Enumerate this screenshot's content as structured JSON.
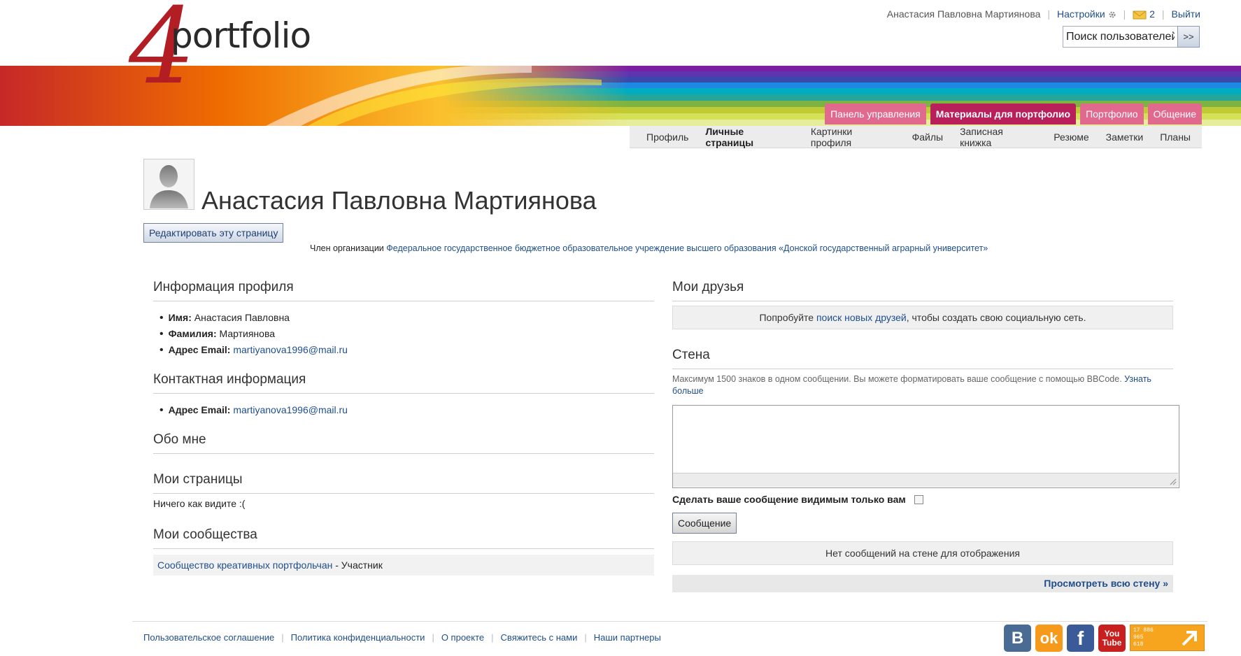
{
  "brand": {
    "logo_text": "portfolio",
    "logo_digit": "4"
  },
  "header": {
    "user_name": "Анастасия Павловна Мартиянова",
    "settings_label": "Настройки",
    "messages_count": "2",
    "logout_label": "Выйти",
    "search_placeholder": "Поиск пользователей",
    "search_button": ">>"
  },
  "main_tabs": [
    {
      "label": "Панель управления",
      "active": false
    },
    {
      "label": "Материалы для портфолио",
      "active": true
    },
    {
      "label": "Портфолио",
      "active": false
    },
    {
      "label": "Общение",
      "active": false
    }
  ],
  "sub_nav": [
    {
      "label": "Профиль",
      "active": false
    },
    {
      "label": "Личные страницы",
      "active": true
    },
    {
      "label": "Картинки профиля",
      "active": false
    },
    {
      "label": "Файлы",
      "active": false
    },
    {
      "label": "Записная книжка",
      "active": false
    },
    {
      "label": "Резюме",
      "active": false
    },
    {
      "label": "Заметки",
      "active": false
    },
    {
      "label": "Планы",
      "active": false
    }
  ],
  "profile": {
    "title": "Анастасия Павловна Мартиянова",
    "edit_button": "Редактировать эту страницу",
    "org_prefix": "Член организации",
    "org_name": "Федеральное государственное бюджетное образовательное учреждение высшего образования «Донской государственный аграрный университет»"
  },
  "profile_info": {
    "title": "Информация профиля",
    "first_name_label": "Имя:",
    "first_name": "Анастасия Павловна",
    "last_name_label": "Фамилия:",
    "last_name": "Мартиянова",
    "email_label": "Адрес Email:",
    "email": "martiyanova1996@mail.ru"
  },
  "contact_info": {
    "title": "Контактная информация",
    "email_label": "Адрес Email:",
    "email": "martiyanova1996@mail.ru"
  },
  "about": {
    "title": "Обо мне"
  },
  "my_pages": {
    "title": "Мои страницы",
    "empty_text": "Ничего как видите :("
  },
  "communities": {
    "title": "Мои сообщества",
    "items": [
      {
        "name": "Сообщество креативных портфольчан",
        "role": " - Участник"
      }
    ]
  },
  "friends": {
    "title": "Мои друзья",
    "prefix": "Попробуйте ",
    "link": "поиск новых друзей",
    "suffix": ", чтобы создать свою социальную сеть."
  },
  "wall": {
    "title": "Стена",
    "hint": "Максимум 1500 знаков в одном сообщении. Вы можете форматировать ваше сообщение с помощью BBCode. ",
    "hint_link": "Узнать больше",
    "private_label": "Сделать ваше сообщение видимым только вам",
    "post_button": "Сообщение",
    "empty_text": "Нет сообщений на стене для отображения",
    "view_all": "Просмотреть всю стену »"
  },
  "footer": {
    "links": [
      "Пользовательское соглашение",
      "Политика конфиденциальности",
      "О проекте",
      "Свяжитесь с нами",
      "Наши партнеры"
    ],
    "social": [
      {
        "name": "vk",
        "glyph": "B"
      },
      {
        "name": "ok",
        "glyph": "ok"
      },
      {
        "name": "facebook",
        "glyph": "f"
      },
      {
        "name": "youtube",
        "glyph_top": "You",
        "glyph_bottom": "Tube"
      }
    ],
    "counter_digits": [
      "17 886",
      "965",
      "618"
    ]
  },
  "colors": {
    "tab_active": "#b81f5b",
    "tab_inactive": "#e0698d",
    "link": "#1f4e8c"
  }
}
